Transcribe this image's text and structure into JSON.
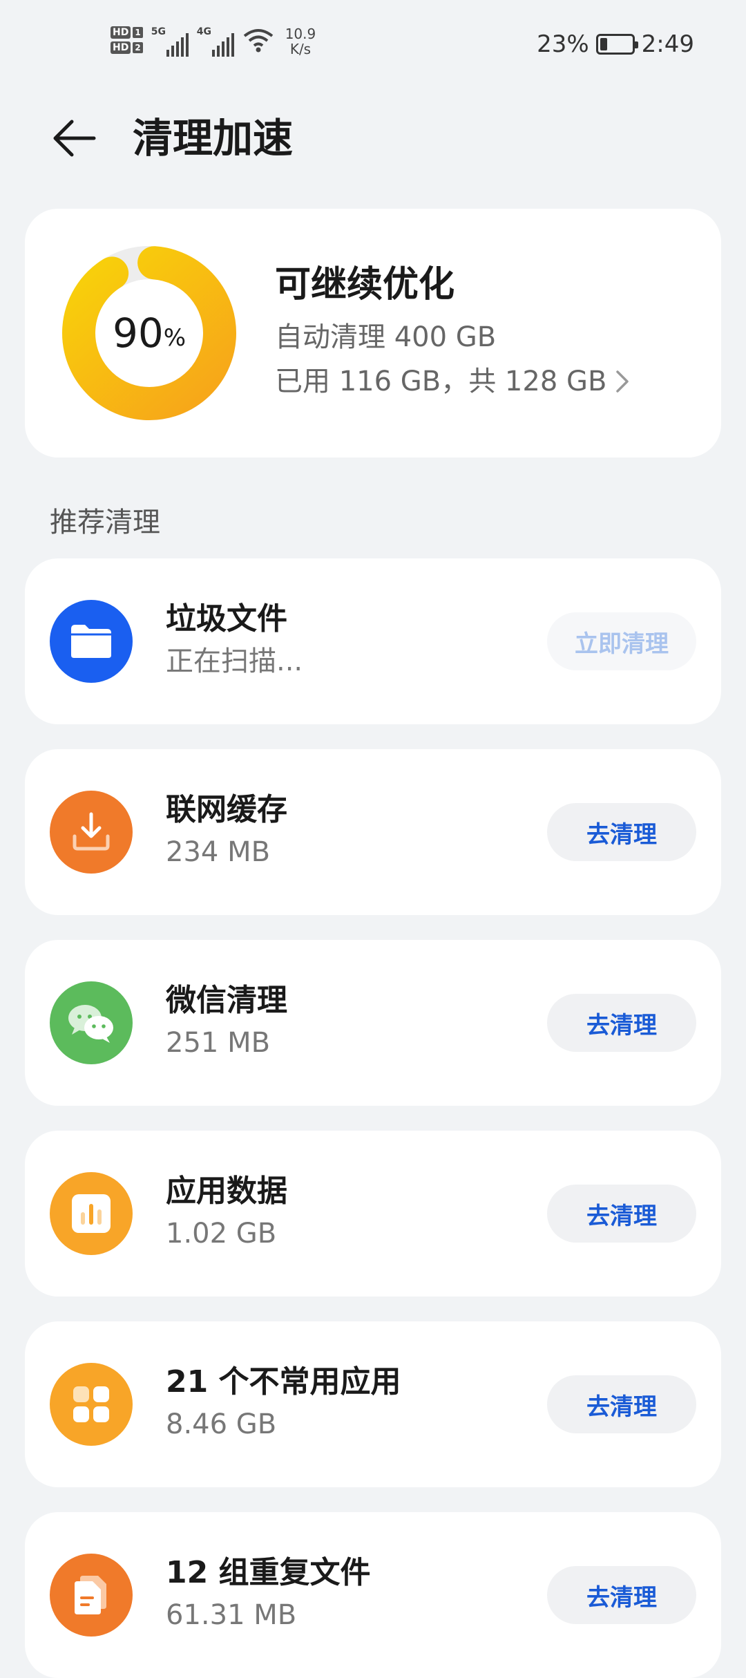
{
  "status_bar": {
    "net1": "5G",
    "net2": "4G",
    "speed_value": "10.9",
    "speed_unit": "K/s",
    "battery_percent": "23%",
    "battery_level": 0.23,
    "time": "2:49"
  },
  "header": {
    "title": "清理加速"
  },
  "storage": {
    "percent_value": "90",
    "percent_sign": "%",
    "percent": 90,
    "title": "可继续优化",
    "auto_clean": "自动清理 400 GB",
    "usage": "已用 116 GB，共 128 GB"
  },
  "section": {
    "title": "推荐清理"
  },
  "items": [
    {
      "title": "垃圾文件",
      "subtitle": "正在扫描...",
      "button": "立即清理",
      "icon": "folder-icon",
      "color": "#1a5ff0"
    },
    {
      "title": "联网缓存",
      "subtitle": "234 MB",
      "button": "去清理",
      "icon": "download-icon",
      "color": "#f07a2a"
    },
    {
      "title": "微信清理",
      "subtitle": "251 MB",
      "button": "去清理",
      "icon": "wechat-icon",
      "color": "#5cbb5c"
    },
    {
      "title": "应用数据",
      "subtitle": "1.02 GB",
      "button": "去清理",
      "icon": "bar-chart-icon",
      "color": "#f8a528"
    },
    {
      "title": "21 个不常用应用",
      "subtitle": "8.46 GB",
      "button": "去清理",
      "icon": "apps-grid-icon",
      "color": "#f8a528"
    },
    {
      "title": "12 组重复文件",
      "subtitle": "61.31 MB",
      "button": "去清理",
      "icon": "duplicate-files-icon",
      "color": "#f07a2a"
    }
  ]
}
